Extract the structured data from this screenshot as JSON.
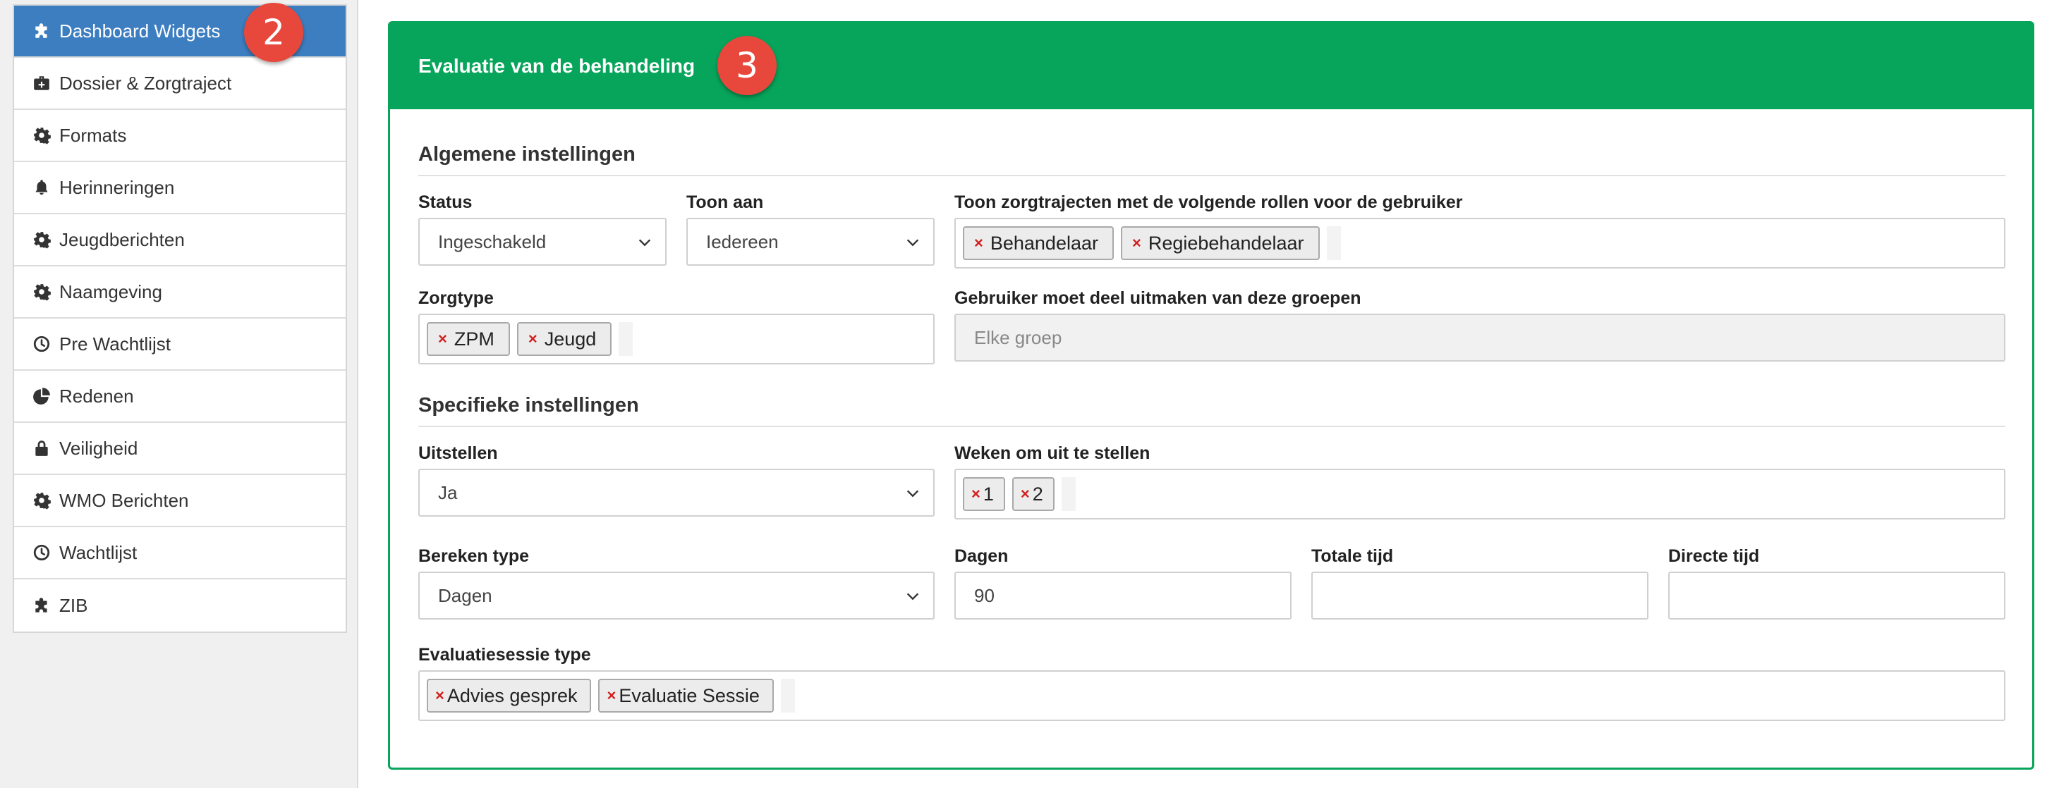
{
  "sidebar": {
    "items": [
      {
        "label": "Dashboard Widgets",
        "icon": "puzzle-icon",
        "active": true
      },
      {
        "label": "Dossier & Zorgtraject",
        "icon": "medkit-icon"
      },
      {
        "label": "Formats",
        "icon": "gear-icon"
      },
      {
        "label": "Herinneringen",
        "icon": "bell-icon"
      },
      {
        "label": "Jeugdberichten",
        "icon": "gear-icon"
      },
      {
        "label": "Naamgeving",
        "icon": "gear-icon"
      },
      {
        "label": "Pre Wachtlijst",
        "icon": "clock-icon"
      },
      {
        "label": "Redenen",
        "icon": "pie-chart-icon"
      },
      {
        "label": "Veiligheid",
        "icon": "lock-icon"
      },
      {
        "label": "WMO Berichten",
        "icon": "gear-icon"
      },
      {
        "label": "Wachtlijst",
        "icon": "clock-icon"
      },
      {
        "label": "ZIB",
        "icon": "puzzle-icon"
      }
    ]
  },
  "badges": {
    "sidebar": "2",
    "panel": "3"
  },
  "panel": {
    "title": "Evaluatie van de behandeling",
    "general": {
      "title": "Algemene instellingen",
      "status": {
        "label": "Status",
        "value": "Ingeschakeld"
      },
      "toon_aan": {
        "label": "Toon aan",
        "value": "Iedereen"
      },
      "rollen": {
        "label": "Toon zorgtrajecten met de volgende rollen voor de gebruiker",
        "tags": [
          "Behandelaar",
          "Regiebehandelaar"
        ]
      },
      "zorgtype": {
        "label": "Zorgtype",
        "tags": [
          "ZPM",
          "Jeugd"
        ]
      },
      "groepen": {
        "label": "Gebruiker moet deel uitmaken van deze groepen",
        "placeholder": "Elke groep"
      }
    },
    "specific": {
      "title": "Specifieke instellingen",
      "uitstellen": {
        "label": "Uitstellen",
        "value": "Ja"
      },
      "weken": {
        "label": "Weken om uit te stellen",
        "tags": [
          "1",
          "2"
        ]
      },
      "bereken": {
        "label": "Bereken type",
        "value": "Dagen"
      },
      "dagen": {
        "label": "Dagen",
        "value": "90"
      },
      "totale": {
        "label": "Totale tijd",
        "value": ""
      },
      "directe": {
        "label": "Directe tijd",
        "value": ""
      },
      "sessie": {
        "label": "Evaluatiesessie type",
        "tags": [
          "Advies gesprek",
          "Evaluatie Sessie"
        ]
      }
    }
  },
  "colors": {
    "accent_green": "#07a55b",
    "sidebar_active": "#3d7ec1",
    "badge_red": "#e8483c",
    "tag_x": "#d21f1f"
  }
}
